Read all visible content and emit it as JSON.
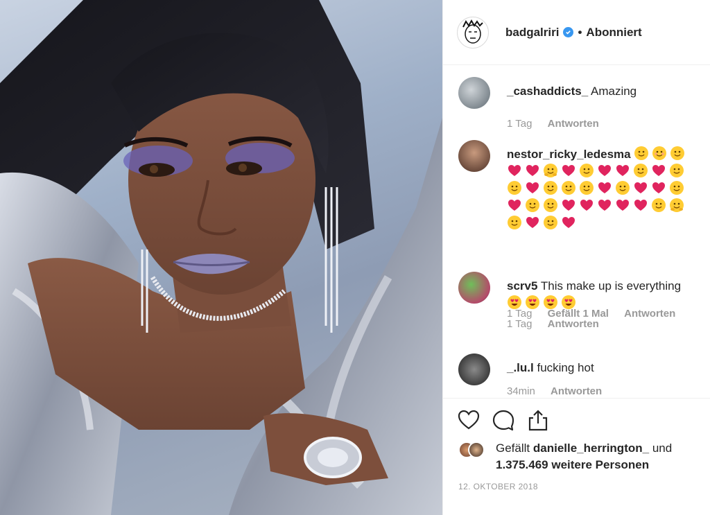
{
  "post": {
    "username": "badgalriri",
    "follow_state": "Abonniert",
    "dot": "•"
  },
  "comments": [
    {
      "user": "_cashaddicts_",
      "text": "Amazing",
      "emojis": [],
      "time": "1 Tag",
      "likes": "",
      "reply": "Antworten"
    },
    {
      "user": "nestor_ricky_ledesma",
      "text": "",
      "emojis": [
        "smile",
        "blush",
        "smile",
        "heart",
        "heart",
        "hug",
        "heart",
        "smile",
        "heart",
        "heart",
        "smile",
        "heart",
        "smile",
        "smile",
        "heart",
        "smile",
        "smile",
        "smile",
        "heart",
        "smile",
        "heart",
        "heart",
        "smile",
        "heart",
        "smile",
        "smile",
        "heart",
        "heart",
        "heart",
        "heart",
        "heart",
        "smile",
        "hug",
        "smile",
        "heart",
        "smile",
        "heart"
      ],
      "time": "1 Tag",
      "likes": "Gefällt 1 Mal",
      "reply": "Antworten"
    },
    {
      "user": "scrv5",
      "text": "This make up is everything",
      "emojis": [
        "hearteyes",
        "hearteyes",
        "hearteyes",
        "hearteyes"
      ],
      "time": "1 Tag",
      "likes": "",
      "reply": "Antworten"
    },
    {
      "user": "_.lu.l",
      "text": "fucking hot",
      "emojis": [],
      "time": "34min",
      "likes": "",
      "reply": "Antworten"
    }
  ],
  "likes": {
    "prefix": "Gefällt",
    "user": "danielle_herrington_",
    "conj": "und",
    "count_text": "1.375.469 weitere Personen"
  },
  "date": "12. OKTOBER 2018",
  "icons": {
    "like": "heart-outline-icon",
    "comment": "comment-bubble-icon",
    "share": "share-upload-icon",
    "verified": "verified-badge-icon"
  },
  "colors": {
    "verified": "#3897f0",
    "meta_text": "#999999",
    "text": "#262626",
    "emoji_heart": "#e0245e",
    "emoji_face": "#ffcc33"
  }
}
